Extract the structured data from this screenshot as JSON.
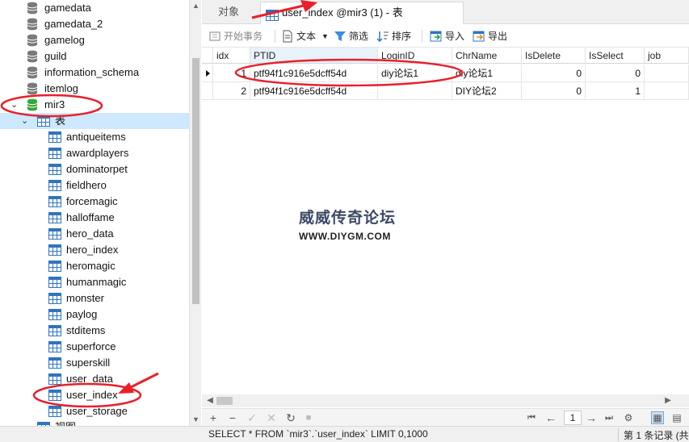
{
  "tree": {
    "databases_above": [
      "gamedata",
      "gamedata_2",
      "gamelog",
      "guild",
      "information_schema",
      "itemlog"
    ],
    "open_database": "mir3",
    "tables_folder": "表",
    "tables": [
      "antiqueitems",
      "awardplayers",
      "dominatorpet",
      "fieldhero",
      "forcemagic",
      "halloffame",
      "hero_data",
      "hero_index",
      "heromagic",
      "humanmagic",
      "monster",
      "paylog",
      "stditems",
      "superforce",
      "superskill",
      "user_data",
      "user_index",
      "user_storage"
    ],
    "views_folder_partial": "视图"
  },
  "tabs": {
    "objects": "对象",
    "active": "user_index @mir3 (1) - 表"
  },
  "toolbar": {
    "begin_transaction": "开始事务",
    "text": "文本",
    "filter": "筛选",
    "sort": "排序",
    "import": "导入",
    "export": "导出"
  },
  "grid": {
    "columns": [
      "idx",
      "PTID",
      "LoginID",
      "ChrName",
      "IsDelete",
      "IsSelect",
      "job"
    ],
    "rows": [
      {
        "idx": "1",
        "PTID": "ptf94f1c916e5dcff54d",
        "LoginID": "diy论坛1",
        "ChrName": "diy论坛1",
        "IsDelete": "0",
        "IsSelect": "0"
      },
      {
        "idx": "2",
        "PTID": "ptf94f1c916e5dcff54d",
        "LoginID": "",
        "ChrName": "DIY论坛2",
        "IsDelete": "0",
        "IsSelect": "1"
      }
    ]
  },
  "watermark": {
    "title": "威威传奇论坛",
    "site": "WWW.DIYGM.COM"
  },
  "bottom": {
    "page": "1"
  },
  "status": {
    "sql": "SELECT * FROM `mir3`.`user_index` LIMIT 0,1000",
    "record": "第 1 条记录 (共"
  },
  "colors": {
    "annotation_red": "#e8202a",
    "selection_blue": "#cde8ff",
    "db_open_green": "#3aa53a"
  }
}
